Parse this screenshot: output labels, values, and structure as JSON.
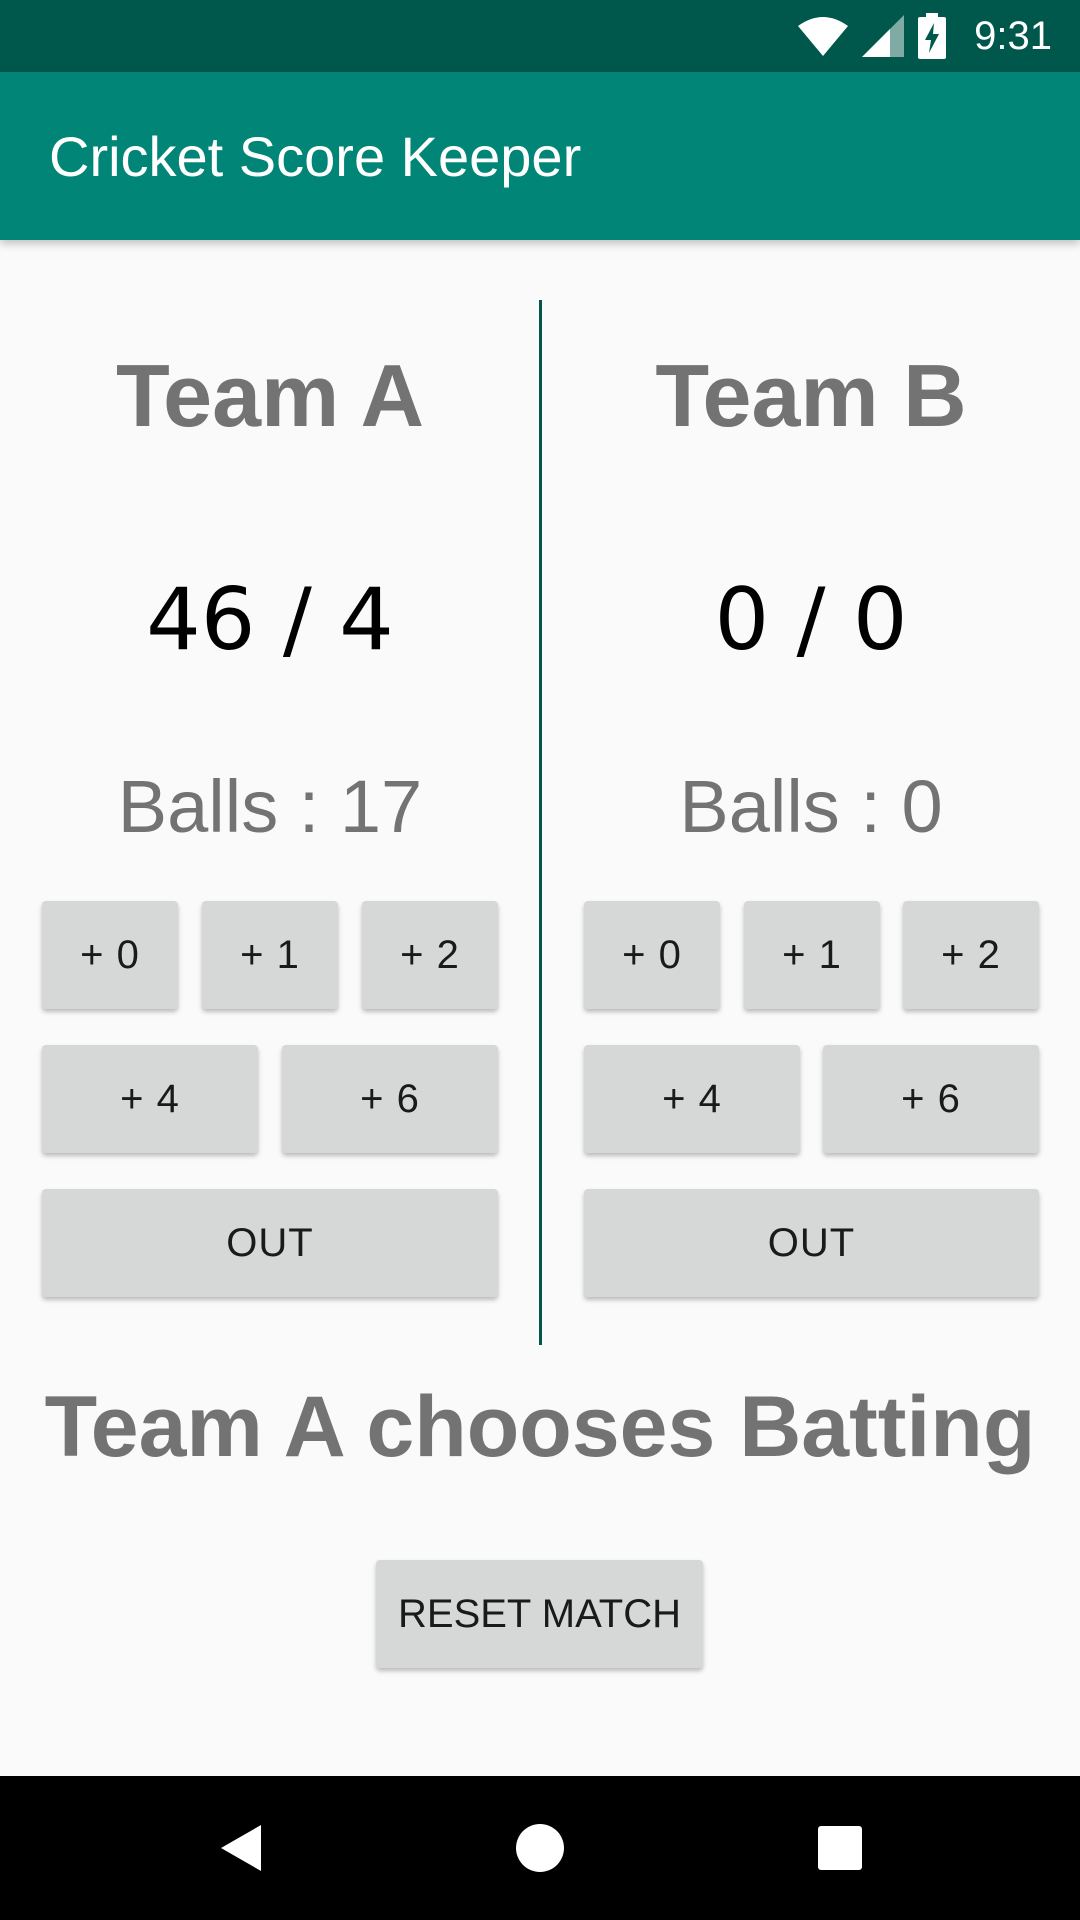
{
  "status_bar": {
    "time": "9:31",
    "icons": [
      "wifi-icon",
      "signal-icon",
      "battery-charging-icon"
    ]
  },
  "app_bar": {
    "title": "Cricket Score Keeper"
  },
  "team_a": {
    "name": "Team A",
    "score": "46 / 4",
    "balls": "Balls : 17",
    "buttons": {
      "plus0": "+ 0",
      "plus1": "+ 1",
      "plus2": "+ 2",
      "plus4": "+ 4",
      "plus6": "+ 6",
      "out": "OUT"
    }
  },
  "team_b": {
    "name": "Team B",
    "score": "0 / 0",
    "balls": "Balls : 0",
    "buttons": {
      "plus0": "+ 0",
      "plus1": "+ 1",
      "plus2": "+ 2",
      "plus4": "+ 4",
      "plus6": "+ 6",
      "out": "OUT"
    }
  },
  "batting_status": "Team A chooses Batting",
  "reset_button": "RESET MATCH",
  "nav_bar": {
    "icons": [
      "back-icon",
      "home-icon",
      "recents-icon"
    ]
  },
  "colors": {
    "status_bar": "#00574b",
    "app_bar": "#008577",
    "divider": "#00574b",
    "button": "#d6d7d7",
    "muted_text": "#737373"
  }
}
